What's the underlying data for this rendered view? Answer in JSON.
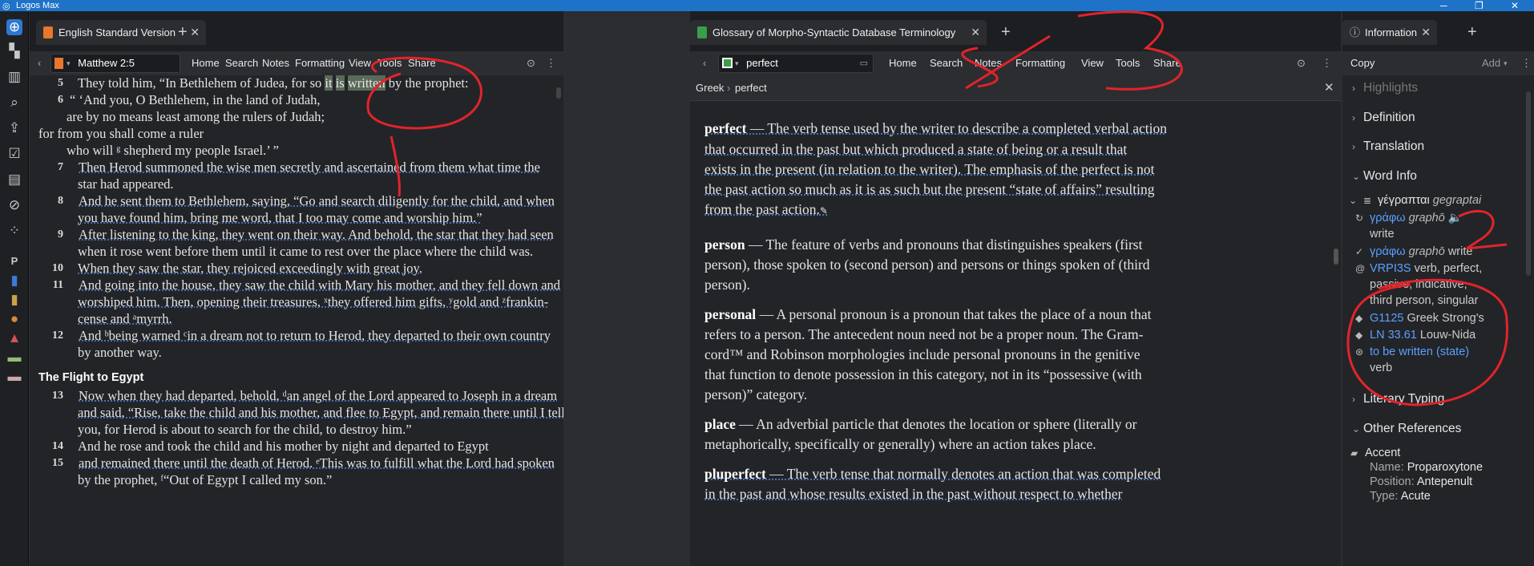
{
  "window": {
    "title": "Logos Max",
    "controls": [
      "─",
      "❐",
      "✕"
    ]
  },
  "rail": {
    "icons": [
      "home-icon",
      "layout-icon",
      "library-icon",
      "search-icon",
      "upload-icon",
      "checklist-icon",
      "document-icon",
      "shield-icon",
      "apps-icon",
      "p-icon",
      "book-icon",
      "bookmark-icon",
      "cloud-icon",
      "layers-icon",
      "briefcase-icon",
      "stack-icon"
    ]
  },
  "bible_panel": {
    "tab_label": "English Standard Version",
    "reference": "Matthew 2:5",
    "menu": [
      "Home",
      "Search",
      "Notes",
      "Formatting",
      "View",
      "Tools",
      "Share"
    ],
    "verses": [
      {
        "n": "5",
        "pre": "They told him, “In Bethlehem of Judea, for so ",
        "h1": "it",
        "h2": "is",
        "h3": "written",
        "post": " by the prophet:"
      },
      {
        "n": "6",
        "text": "“ ‘And you, O Bethlehem, in the land of Judah,"
      },
      {
        "text": "are by no means least among the rulers of Judah;"
      },
      {
        "text": "for from you shall come a ruler"
      },
      {
        "text": "who will ᵍ shepherd my people Israel.’ ”"
      },
      {
        "n": "7",
        "text": "Then Herod summoned the wise men secretly and ascertained from them what time the"
      },
      {
        "text": "star had appeared."
      },
      {
        "n": "8",
        "text": "And he sent them to Bethlehem, saying, “Go and search diligently for the child, and when"
      },
      {
        "text": "you have found him, bring me word, that I too may come and worship him.”"
      },
      {
        "n": "9",
        "text": "After listening to the king, they went on their way. And behold, the star that they had seen"
      },
      {
        "text": "when it rose went before them until it came to rest over the place where the child was."
      },
      {
        "n": "10",
        "text": "When they saw the star, they rejoiced exceedingly with great joy."
      },
      {
        "n": "11",
        "text": "And going into the house, they saw the child with Mary his mother, and they fell down and"
      },
      {
        "text": "worshiped him. Then, opening their treasures, ˣthey offered him gifts, ʸgold and ᶻfrankin-"
      },
      {
        "text": "cense and ᵃmyrrh."
      },
      {
        "n": "12",
        "text": "And ᵇbeing warned ᶜin a dream not to return to Herod, they departed to their own country"
      },
      {
        "text": "by another way."
      },
      {
        "heading": "The Flight to Egypt"
      },
      {
        "n": "13",
        "text": "Now when they had departed, behold, ᵈan angel of the Lord appeared to Joseph in a dream"
      },
      {
        "text": "and said, “Rise, take the child and his mother, and flee to Egypt, and remain there until I tell"
      },
      {
        "text": "you, for Herod is about to search for the child, to destroy him.”"
      },
      {
        "n": "14",
        "text": "And he rose and took the child and his mother by night and departed to Egypt"
      },
      {
        "n": "15",
        "text": "and remained there until the death of Herod. ᵉThis was to fulfill what the Lord had spoken"
      },
      {
        "text": "by the prophet, ᶠ“Out of Egypt I called my son.”"
      }
    ]
  },
  "glossary_panel": {
    "tab_label": "Glossary of Morpho-Syntactic Database Terminology",
    "search_value": "perfect",
    "menu": [
      "Home",
      "Search",
      "Notes",
      "Formatting",
      "View",
      "Tools",
      "Share"
    ],
    "breadcrumb": [
      "Greek",
      "perfect"
    ],
    "lines": [
      {
        "term": "perfect",
        "rest": " — The verb tense used by the writer to describe a completed verbal action"
      },
      {
        "rest": "that occurred in the past but which produced a state of being or a result that"
      },
      {
        "rest": "exists in the present (in relation to the writer). The emphasis of the perfect is not"
      },
      {
        "rest": "the past action so much as it is as such but the present “state of affairs” resulting"
      },
      {
        "rest": "from the past action."
      },
      {
        "term": "person",
        "rest": " — The feature of verbs and pronouns that distinguishes speakers (first"
      },
      {
        "rest": "person), those spoken to (second person) and persons or things spoken of (third"
      },
      {
        "rest": "person)."
      },
      {
        "term": "personal",
        "rest": " — A personal pronoun is a pronoun that takes the place of a noun that"
      },
      {
        "rest": "refers to a person. The antecedent noun need not be a proper noun. The Gram-"
      },
      {
        "rest": "cord™ and Robinson morphologies include personal pronouns in the genitive"
      },
      {
        "rest": "that function to denote possession in this category, not in its “possessive (with"
      },
      {
        "rest": "person)” category."
      },
      {
        "term": "place",
        "rest": " — An adverbial particle that denotes the location or sphere (literally or"
      },
      {
        "rest": "metaphorically, specifically or generally) where an action takes place."
      },
      {
        "term": "pluperfect",
        "rest": " — The verb tense that normally denotes an action that was completed"
      },
      {
        "rest": "in the past and whose results existed in the past without respect to whether"
      }
    ]
  },
  "info_panel": {
    "tab_label": "Information",
    "copy_label": "Copy",
    "add_label": "Add",
    "sections": {
      "highlights": "Highlights",
      "definition": "Definition",
      "translation": "Translation",
      "word_info": "Word Info",
      "literary_typing": "Literary Typing",
      "other_references": "Other References"
    },
    "word": {
      "greek": "γέγραπται",
      "translit": "gegraptai"
    },
    "lemma1": {
      "greek": "γράφω",
      "translit": "graphō",
      "gloss": "write"
    },
    "lemma2": {
      "greek": "γράφω",
      "translit": "graphō",
      "gloss": "write"
    },
    "morph": {
      "code": "VRPI3S",
      "desc1": "verb, perfect,",
      "desc2": "passive, indicative,",
      "desc3": "third person, singular"
    },
    "strongs": {
      "code": "G1125",
      "label": "Greek Strong's"
    },
    "louw": {
      "code": "LN 33.61",
      "label": "Louw-Nida"
    },
    "sense": {
      "text": "to be written (state)",
      "pos": "verb"
    },
    "accent": {
      "title": "Accent",
      "name_label": "Name:",
      "name_value": "Proparoxytone",
      "pos_label": "Position:",
      "pos_value": "Antepenult",
      "type_label": "Type:",
      "type_value": "Acute"
    }
  },
  "colors": {
    "accent": "#2e77d0",
    "link": "#5aa0ff",
    "ink": "#e0242a",
    "highlight": "#5a6a5a"
  }
}
